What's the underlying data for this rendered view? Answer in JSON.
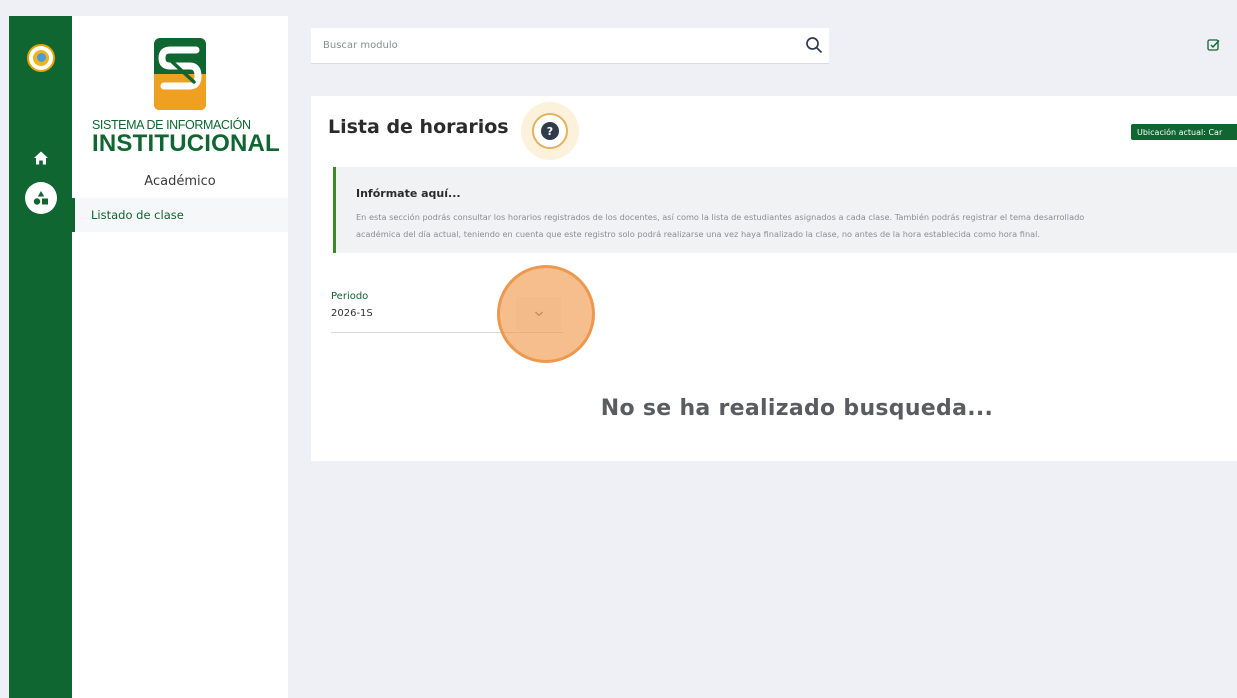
{
  "rail": {
    "items": [
      {
        "icon": "app-logo-icon"
      },
      {
        "icon": "home-icon"
      },
      {
        "icon": "academic-shapes-icon"
      }
    ]
  },
  "brand": {
    "line1": "SISTEMA DE INFORMACIÓN",
    "line2": "INSTITUCIONAL",
    "colors": {
      "green": "#0f6630",
      "orange": "#f0a020"
    }
  },
  "sidebar": {
    "section_title": "Académico",
    "items": [
      {
        "label": "Listado de clase",
        "active": true
      }
    ]
  },
  "search": {
    "placeholder": "Buscar modulo"
  },
  "main": {
    "title": "Lista de horarios",
    "help_icon": "?",
    "location_badge": "Ubicación actual: Car",
    "info": {
      "title": "Infórmate aquí...",
      "line1": "En esta sección podrás consultar los horarios registrados de los docentes, así como la lista de estudiantes asignados a cada clase. También podrás registrar el tema desarrollado",
      "line2": "académica del día actual, teniendo en cuenta que este registro solo podrá realizarse una vez haya finalizado la clase, no antes de la hora establecida como hora final."
    },
    "periodo": {
      "label": "Periodo",
      "value": "2026-1S"
    },
    "empty_message": "No se ha realizado busqueda..."
  }
}
